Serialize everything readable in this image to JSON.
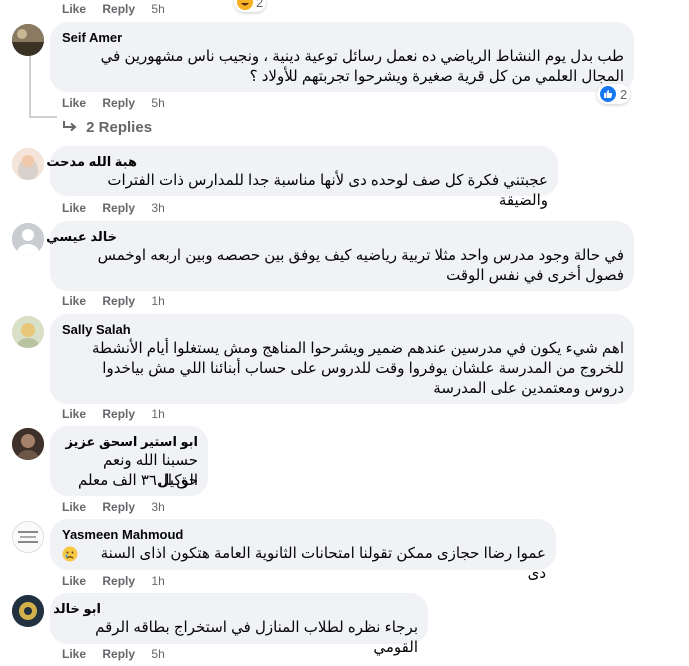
{
  "comments": [
    {
      "name": "",
      "text": "",
      "like": "Like",
      "reply": "Reply",
      "time": "5h",
      "reaction_count": "2"
    },
    {
      "name": "Seif Amer",
      "text": "طب بدل يوم النشاط الرياضي ده نعمل رسائل توعية دينية ، ونجيب ناس مشهورين في المجال العلمي من كل قرية صغيرة ويشرحوا تجربتهم للأولاد ؟",
      "like": "Like",
      "reply": "Reply",
      "time": "5h",
      "reaction_count": "2",
      "replies_label": "2 Replies"
    },
    {
      "name": "هبة الله مدحت",
      "text": "عجبتني فكرة كل صف لوحده دى لأنها مناسبة جدا للمدارس ذات الفترات والضيقة",
      "like": "Like",
      "reply": "Reply",
      "time": "3h"
    },
    {
      "name": "خالد عيسي",
      "text": "في حالة وجود مدرس واحد مثلا تربية رياضيه كيف يوفق بين حصصه وبين اربعه اوخمس فصول أخرى في نفس الوقت",
      "like": "Like",
      "reply": "Reply",
      "time": "1h"
    },
    {
      "name": "Sally Salah",
      "text": "اهم شيء يكون في مدرسين عندهم ضمير ويشرحوا المناهج ومش يستغلوا أيام الأنشطة للخروج من المدرسة علشان يوفروا وقت للدروس على حساب أبنائنا اللي مش بياخدوا دروس ومعتمدين على المدرسة",
      "like": "Like",
      "reply": "Reply",
      "time": "1h"
    },
    {
      "name": "ابو استير اسحق عزيز",
      "line1": "حسبنا الله ونعم الوكيل",
      "line2": "حق ال٣٦ الف معلم",
      "like": "Like",
      "reply": "Reply",
      "time": "3h"
    },
    {
      "name": "Yasmeen Mahmoud",
      "text": "عموا رضاا حجازى ممكن تقولنا امتحانات الثانوية العامة هتكون اذاى السنة دى",
      "like": "Like",
      "reply": "Reply",
      "time": "1h"
    },
    {
      "name": "ابو خالد",
      "text": "برجاء نظره لطلاب المنازل في استخراج بطاقه الرقم القومي",
      "like": "Like",
      "reply": "Reply",
      "time": "5h"
    }
  ],
  "colors": {
    "bubble": "#f0f2f5",
    "meta": "#65676b",
    "like_blue": "#1877f2",
    "text": "#050505"
  },
  "icons": [
    "like-icon",
    "haha-icon",
    "reply-arrow-icon",
    "sad-emoji-icon"
  ]
}
